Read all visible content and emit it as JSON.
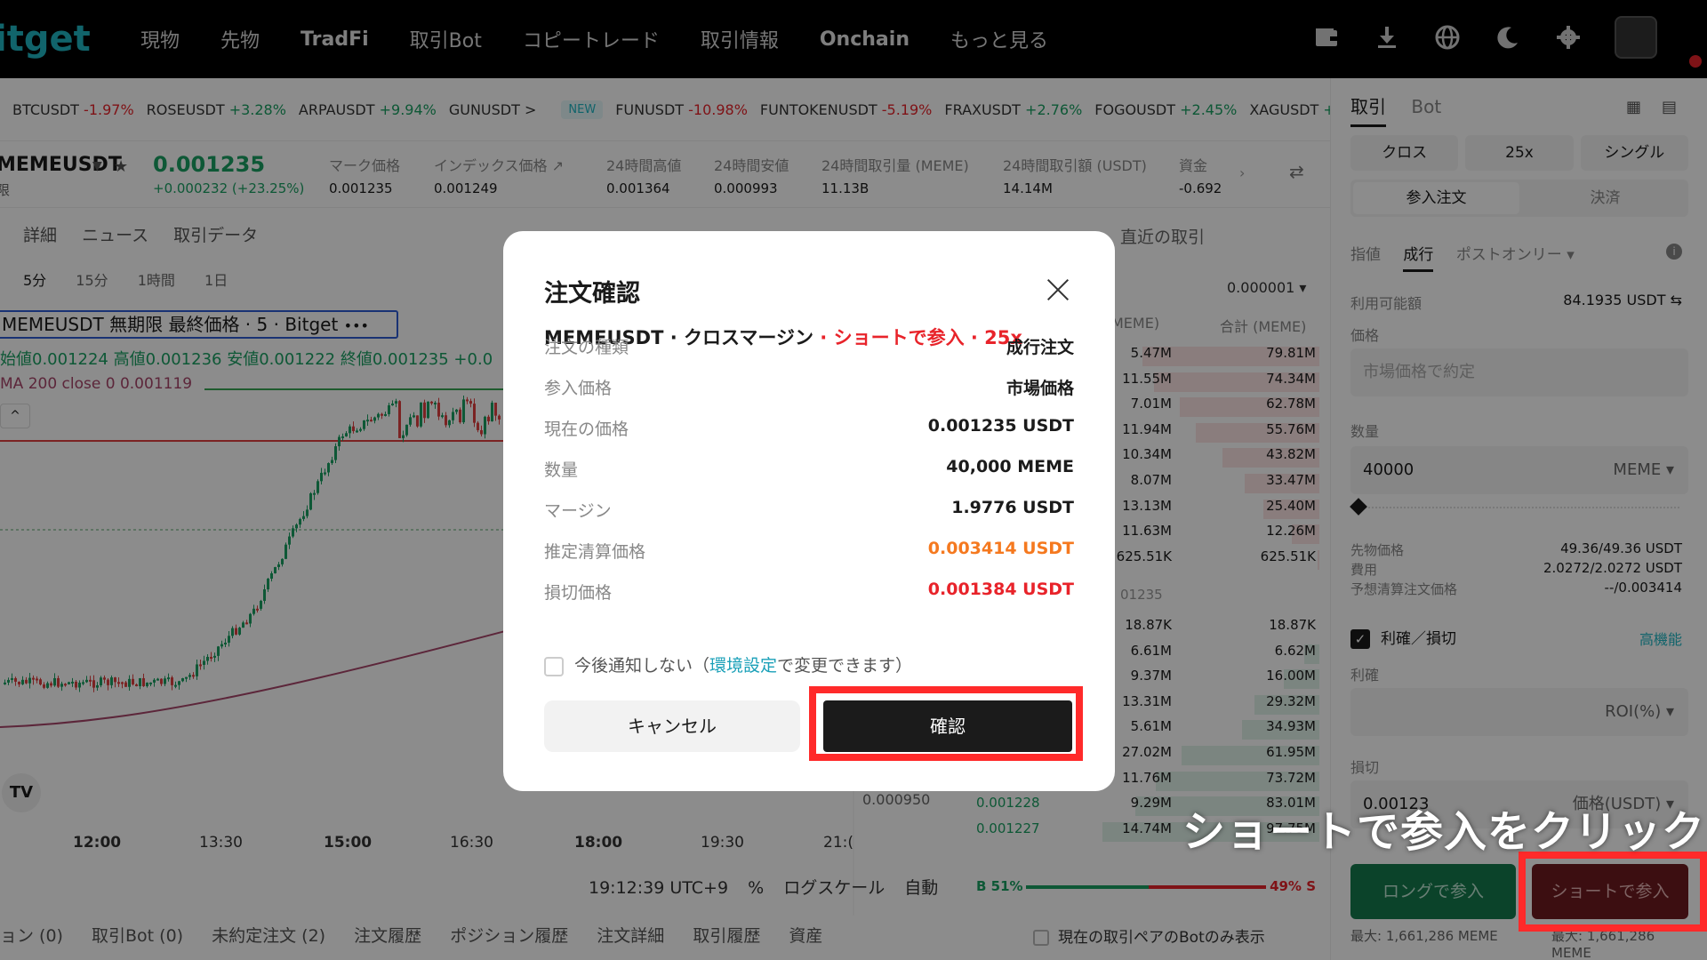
{
  "nav": {
    "logo": "itget",
    "items": [
      "現物",
      "先物",
      "TradFi",
      "取引Bot",
      "コピートレード",
      "取引情報",
      "Onchain",
      "もっと見る"
    ]
  },
  "ticker": {
    "items": [
      {
        "sym": "BTCUSDT",
        "ch": "-1.97%",
        "neg": true
      },
      {
        "sym": "ROSEUSDT",
        "ch": "+3.28%",
        "neg": false
      },
      {
        "sym": "ARPAUSDT",
        "ch": "+9.94%",
        "neg": false
      },
      {
        "sym": "GUNUSDT",
        "ch": ">",
        "neg": null
      }
    ],
    "new_badge": "NEW",
    "items2": [
      {
        "sym": "FUNUSDT",
        "ch": "-10.98%",
        "neg": true
      },
      {
        "sym": "FUNTOKENUSDT",
        "ch": "-5.19%",
        "neg": true
      },
      {
        "sym": "FRAXUSDT",
        "ch": "+2.76%",
        "neg": false
      },
      {
        "sym": "FOGOUSDT",
        "ch": "+2.45%",
        "neg": false
      },
      {
        "sym": "XAGUSDT",
        "ch": "+ >",
        "neg": false
      }
    ]
  },
  "symbol": {
    "name": "MEMEUSDT",
    "sub": "限",
    "price": "0.001235",
    "change": "+0.000232 (+23.25%)",
    "stats": [
      {
        "k": "マーク価格",
        "v": "0.001235"
      },
      {
        "k": "インデックス価格 ↗",
        "v": "0.001249"
      },
      {
        "k": "24時間高値",
        "v": "0.001364"
      },
      {
        "k": "24時間安値",
        "v": "0.000993"
      },
      {
        "k": "24時間取引量 (MEME)",
        "v": "11.13B"
      },
      {
        "k": "24時間取引額 (USDT)",
        "v": "14.14M"
      },
      {
        "k": "資金",
        "v": "-0.692"
      }
    ]
  },
  "chart_tabs": [
    "詳細",
    "ニュース",
    "取引データ"
  ],
  "intervals": [
    "5分",
    "15分",
    "1時間",
    "1日"
  ],
  "legend": "MEMEUSDT 無期限 最終価格 · 5 · Bitget",
  "ohlc": "始値0.001224 高値0.001236 安値0.001222 終値0.001235 +0.0",
  "ma": "MA 200 close 0  0.001119",
  "time_axis": [
    "12:00",
    "13:30",
    "15:00",
    "16:30",
    "18:00",
    "19:30",
    "21:("
  ],
  "clock": {
    "time": "19:12:39 UTC+9",
    "pct": "%",
    "log": "ログスケール",
    "auto": "自動"
  },
  "side_price": "0.000950",
  "orderbook": {
    "header": "直近の取引",
    "tick": "0.000001 ▾",
    "col1": "MEME)",
    "col2": "合計 (MEME)",
    "asks": [
      {
        "a": "5.47M",
        "t": "79.81M"
      },
      {
        "a": "11.55M",
        "t": "74.34M"
      },
      {
        "a": "7.01M",
        "t": "62.78M"
      },
      {
        "a": "11.94M",
        "t": "55.76M"
      },
      {
        "a": "10.34M",
        "t": "43.82M"
      },
      {
        "a": "8.07M",
        "t": "33.47M"
      },
      {
        "a": "13.13M",
        "t": "25.40M"
      },
      {
        "a": "11.63M",
        "t": "12.26M"
      },
      {
        "a": "625.51K",
        "t": "625.51K"
      }
    ],
    "mid": "01235",
    "bids": [
      {
        "a": "18.87K",
        "t": "18.87K"
      },
      {
        "a": "6.61M",
        "t": "6.62M"
      },
      {
        "a": "9.37M",
        "t": "16.00M"
      },
      {
        "a": "13.31M",
        "t": "29.32M"
      },
      {
        "a": "5.61M",
        "t": "34.93M"
      },
      {
        "a": "27.02M",
        "t": "61.95M"
      },
      {
        "a": "11.76M",
        "t": "73.72M"
      },
      {
        "a": "9.29M",
        "t": "83.01M",
        "p": "0.001228"
      },
      {
        "a": "14.74M",
        "t": "97.75M",
        "p": "0.001227"
      }
    ],
    "buy_ratio": "B 51%",
    "sell_ratio": "49% S",
    "buy_share": 0.51
  },
  "bottom_tabs": [
    "ョン (0)",
    "取引Bot (0)",
    "未約定注文 (2)",
    "注文履歴",
    "ポジション履歴",
    "注文詳細",
    "取引履歴",
    "資産"
  ],
  "bot_only": "現在の取引ペアのBotのみ表示",
  "order_panel": {
    "tab_trade": "取引",
    "tab_bot": "Bot",
    "mode": [
      "クロス",
      "25x",
      "シングル"
    ],
    "open": "参入注文",
    "close": "決済",
    "types": [
      "指値",
      "成行",
      "ポストオンリー ▾"
    ],
    "available_label": "利用可能額",
    "available_value": "84.1935 USDT ⇆",
    "price_label": "価格",
    "price_placeholder": "市場価格で約定",
    "qty_label": "数量",
    "qty_value": "40000",
    "qty_unit": "MEME ▾",
    "cost_label1": "先物価格",
    "cost_value1": "49.36/49.36 USDT",
    "cost_label2": "費用",
    "cost_value2": "2.0272/2.0272 USDT",
    "cost_label3": "予想清算注文価格",
    "cost_value3": "--/0.003414",
    "tpsl": "利確／損切",
    "advanced": "高機能",
    "tp_label": "利確",
    "tp_unit": "ROI(%) ▾",
    "sl_label": "損切",
    "sl_value": "0.00123",
    "sl_unit": "価格(USDT) ▾",
    "long_btn": "ロングで参入",
    "short_btn": "ショートで参入",
    "max_long": "最大: 1,661,286 MEME",
    "max_short": "最大: 1,661,286 MEME"
  },
  "caption": "ショートで参入をクリック",
  "modal": {
    "title": "注文確認",
    "sub_main": "MEMEUSDT · クロスマージン",
    "sub_red": " · ショートで参入 · 25x",
    "rows": [
      {
        "k": "注文の種類",
        "v": "成行注文",
        "style": ""
      },
      {
        "k": "参入価格",
        "v": "市場価格",
        "style": ""
      },
      {
        "k": "現在の価格",
        "v": "0.001235 USDT",
        "style": ""
      },
      {
        "k": "数量",
        "v": "40,000 MEME",
        "style": ""
      },
      {
        "k": "マージン",
        "v": "1.9776 USDT",
        "style": ""
      },
      {
        "k": "推定清算価格",
        "v": "0.003414 USDT",
        "style": "orange"
      },
      {
        "k": "損切価格",
        "v": "0.001384 USDT",
        "style": "red"
      }
    ],
    "check_pre": "今後通知しない（",
    "check_link": "環境設定",
    "check_post": "で変更できます）",
    "cancel": "キャンセル",
    "confirm": "確認"
  },
  "colors": {
    "up": "#1aa063",
    "down": "#e8232a",
    "accent": "#1fb6c3",
    "highlight": "#ff2a2a"
  }
}
